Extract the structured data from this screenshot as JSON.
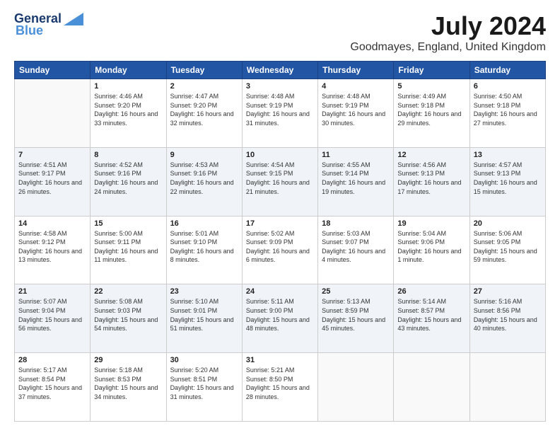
{
  "logo": {
    "general": "General",
    "blue": "Blue"
  },
  "title": "July 2024",
  "location": "Goodmayes, England, United Kingdom",
  "headers": [
    "Sunday",
    "Monday",
    "Tuesday",
    "Wednesday",
    "Thursday",
    "Friday",
    "Saturday"
  ],
  "weeks": [
    [
      {
        "day": "",
        "sunrise": "",
        "sunset": "",
        "daylight": ""
      },
      {
        "day": "1",
        "sunrise": "Sunrise: 4:46 AM",
        "sunset": "Sunset: 9:20 PM",
        "daylight": "Daylight: 16 hours and 33 minutes."
      },
      {
        "day": "2",
        "sunrise": "Sunrise: 4:47 AM",
        "sunset": "Sunset: 9:20 PM",
        "daylight": "Daylight: 16 hours and 32 minutes."
      },
      {
        "day": "3",
        "sunrise": "Sunrise: 4:48 AM",
        "sunset": "Sunset: 9:19 PM",
        "daylight": "Daylight: 16 hours and 31 minutes."
      },
      {
        "day": "4",
        "sunrise": "Sunrise: 4:48 AM",
        "sunset": "Sunset: 9:19 PM",
        "daylight": "Daylight: 16 hours and 30 minutes."
      },
      {
        "day": "5",
        "sunrise": "Sunrise: 4:49 AM",
        "sunset": "Sunset: 9:18 PM",
        "daylight": "Daylight: 16 hours and 29 minutes."
      },
      {
        "day": "6",
        "sunrise": "Sunrise: 4:50 AM",
        "sunset": "Sunset: 9:18 PM",
        "daylight": "Daylight: 16 hours and 27 minutes."
      }
    ],
    [
      {
        "day": "7",
        "sunrise": "Sunrise: 4:51 AM",
        "sunset": "Sunset: 9:17 PM",
        "daylight": "Daylight: 16 hours and 26 minutes."
      },
      {
        "day": "8",
        "sunrise": "Sunrise: 4:52 AM",
        "sunset": "Sunset: 9:16 PM",
        "daylight": "Daylight: 16 hours and 24 minutes."
      },
      {
        "day": "9",
        "sunrise": "Sunrise: 4:53 AM",
        "sunset": "Sunset: 9:16 PM",
        "daylight": "Daylight: 16 hours and 22 minutes."
      },
      {
        "day": "10",
        "sunrise": "Sunrise: 4:54 AM",
        "sunset": "Sunset: 9:15 PM",
        "daylight": "Daylight: 16 hours and 21 minutes."
      },
      {
        "day": "11",
        "sunrise": "Sunrise: 4:55 AM",
        "sunset": "Sunset: 9:14 PM",
        "daylight": "Daylight: 16 hours and 19 minutes."
      },
      {
        "day": "12",
        "sunrise": "Sunrise: 4:56 AM",
        "sunset": "Sunset: 9:13 PM",
        "daylight": "Daylight: 16 hours and 17 minutes."
      },
      {
        "day": "13",
        "sunrise": "Sunrise: 4:57 AM",
        "sunset": "Sunset: 9:13 PM",
        "daylight": "Daylight: 16 hours and 15 minutes."
      }
    ],
    [
      {
        "day": "14",
        "sunrise": "Sunrise: 4:58 AM",
        "sunset": "Sunset: 9:12 PM",
        "daylight": "Daylight: 16 hours and 13 minutes."
      },
      {
        "day": "15",
        "sunrise": "Sunrise: 5:00 AM",
        "sunset": "Sunset: 9:11 PM",
        "daylight": "Daylight: 16 hours and 11 minutes."
      },
      {
        "day": "16",
        "sunrise": "Sunrise: 5:01 AM",
        "sunset": "Sunset: 9:10 PM",
        "daylight": "Daylight: 16 hours and 8 minutes."
      },
      {
        "day": "17",
        "sunrise": "Sunrise: 5:02 AM",
        "sunset": "Sunset: 9:09 PM",
        "daylight": "Daylight: 16 hours and 6 minutes."
      },
      {
        "day": "18",
        "sunrise": "Sunrise: 5:03 AM",
        "sunset": "Sunset: 9:07 PM",
        "daylight": "Daylight: 16 hours and 4 minutes."
      },
      {
        "day": "19",
        "sunrise": "Sunrise: 5:04 AM",
        "sunset": "Sunset: 9:06 PM",
        "daylight": "Daylight: 16 hours and 1 minute."
      },
      {
        "day": "20",
        "sunrise": "Sunrise: 5:06 AM",
        "sunset": "Sunset: 9:05 PM",
        "daylight": "Daylight: 15 hours and 59 minutes."
      }
    ],
    [
      {
        "day": "21",
        "sunrise": "Sunrise: 5:07 AM",
        "sunset": "Sunset: 9:04 PM",
        "daylight": "Daylight: 15 hours and 56 minutes."
      },
      {
        "day": "22",
        "sunrise": "Sunrise: 5:08 AM",
        "sunset": "Sunset: 9:03 PM",
        "daylight": "Daylight: 15 hours and 54 minutes."
      },
      {
        "day": "23",
        "sunrise": "Sunrise: 5:10 AM",
        "sunset": "Sunset: 9:01 PM",
        "daylight": "Daylight: 15 hours and 51 minutes."
      },
      {
        "day": "24",
        "sunrise": "Sunrise: 5:11 AM",
        "sunset": "Sunset: 9:00 PM",
        "daylight": "Daylight: 15 hours and 48 minutes."
      },
      {
        "day": "25",
        "sunrise": "Sunrise: 5:13 AM",
        "sunset": "Sunset: 8:59 PM",
        "daylight": "Daylight: 15 hours and 45 minutes."
      },
      {
        "day": "26",
        "sunrise": "Sunrise: 5:14 AM",
        "sunset": "Sunset: 8:57 PM",
        "daylight": "Daylight: 15 hours and 43 minutes."
      },
      {
        "day": "27",
        "sunrise": "Sunrise: 5:16 AM",
        "sunset": "Sunset: 8:56 PM",
        "daylight": "Daylight: 15 hours and 40 minutes."
      }
    ],
    [
      {
        "day": "28",
        "sunrise": "Sunrise: 5:17 AM",
        "sunset": "Sunset: 8:54 PM",
        "daylight": "Daylight: 15 hours and 37 minutes."
      },
      {
        "day": "29",
        "sunrise": "Sunrise: 5:18 AM",
        "sunset": "Sunset: 8:53 PM",
        "daylight": "Daylight: 15 hours and 34 minutes."
      },
      {
        "day": "30",
        "sunrise": "Sunrise: 5:20 AM",
        "sunset": "Sunset: 8:51 PM",
        "daylight": "Daylight: 15 hours and 31 minutes."
      },
      {
        "day": "31",
        "sunrise": "Sunrise: 5:21 AM",
        "sunset": "Sunset: 8:50 PM",
        "daylight": "Daylight: 15 hours and 28 minutes."
      },
      {
        "day": "",
        "sunrise": "",
        "sunset": "",
        "daylight": ""
      },
      {
        "day": "",
        "sunrise": "",
        "sunset": "",
        "daylight": ""
      },
      {
        "day": "",
        "sunrise": "",
        "sunset": "",
        "daylight": ""
      }
    ]
  ]
}
